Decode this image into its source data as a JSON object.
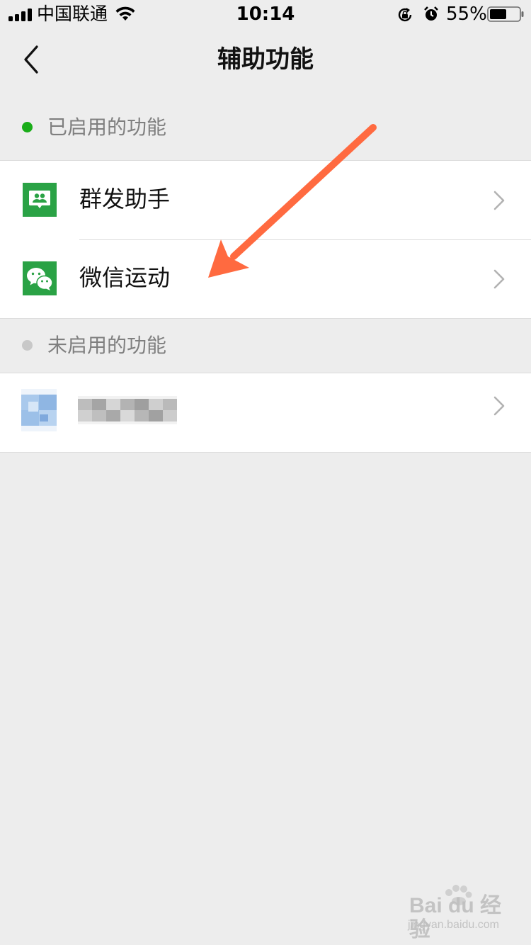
{
  "status_bar": {
    "carrier": "中国联通",
    "time": "10:14",
    "battery": "55%"
  },
  "nav": {
    "title": "辅助功能"
  },
  "sections": {
    "enabled": {
      "label": "已启用的功能",
      "dot_color": "#1aad19",
      "items": [
        {
          "label": "群发助手",
          "icon": "group-message-icon"
        },
        {
          "label": "微信运动",
          "icon": "wechat-icon"
        }
      ]
    },
    "disabled": {
      "label": "未启用的功能",
      "dot_color": "#c8c8c8",
      "items": [
        {
          "label": "",
          "icon": "blurred-app-icon"
        }
      ]
    }
  },
  "annotation": {
    "color": "#ff6a40",
    "icon": "arrow-icon"
  },
  "watermark": {
    "brand": "Bai du 经验",
    "url": "jingyan.baidu.com"
  },
  "colors": {
    "background": "#ededed",
    "icon_green": "#2aa245"
  }
}
